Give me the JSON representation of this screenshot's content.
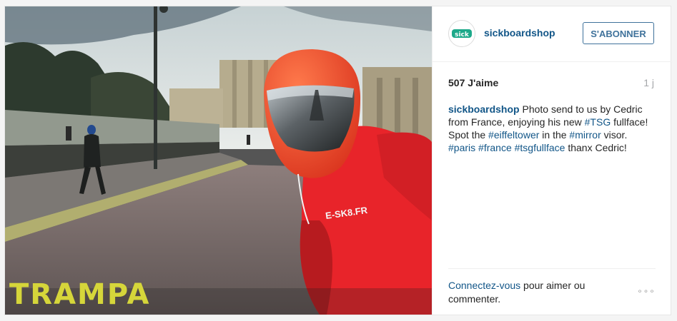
{
  "post": {
    "username": "sickboardshop",
    "follow_label": "S'ABONNER",
    "likes": "507 J'aime",
    "time": "1 j",
    "caption": {
      "user": "sickboardshop",
      "t1": " Photo send to us by Cedric from France, enjoying his new ",
      "tag1": "#TSG",
      "t2": " fullface! Spot the ",
      "tag2": "#eiffeltower",
      "t3": " in the ",
      "tag3": "#mirror",
      "t4": " visor. ",
      "tag4": "#paris",
      "t5": " ",
      "tag5": "#france",
      "t6": " ",
      "tag6": "#tsgfullface",
      "t7": " thanx Cedric!"
    },
    "login_link": "Connectez-vous",
    "login_rest": " pour aimer ou commenter.",
    "more_label": "∘∘∘"
  },
  "photo": {
    "watermark": "TRAMPA",
    "avatar_text": "sick",
    "helmet_text": "E-SK8.FR"
  },
  "colors": {
    "link": "#125688",
    "button": "#3f729b",
    "helmet": "#f24a2c",
    "hoodie": "#e8242a",
    "watermark": "#d6d63a"
  }
}
